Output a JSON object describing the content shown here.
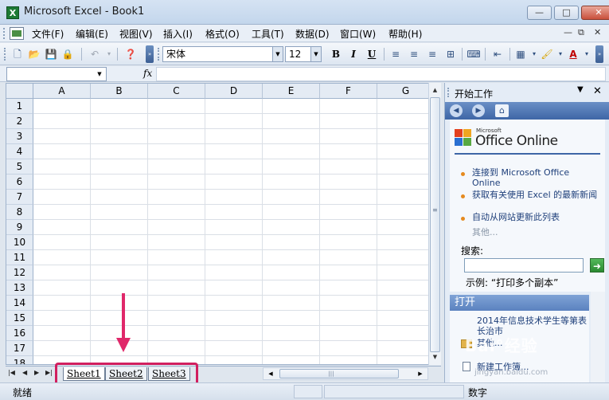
{
  "window": {
    "app_icon": "X",
    "title": "Microsoft Excel - Book1",
    "minimize": "—",
    "restore": "□",
    "close": "✕"
  },
  "menubar": {
    "items": [
      "文件(F)",
      "编辑(E)",
      "视图(V)",
      "插入(I)",
      "格式(O)",
      "工具(T)",
      "数据(D)",
      "窗口(W)",
      "帮助(H)"
    ],
    "controls": [
      "—",
      "⧉",
      "✕"
    ]
  },
  "toolbar": {
    "font_name": "宋体",
    "font_size": "12",
    "bold": "B",
    "italic": "I",
    "underline": "U"
  },
  "formula_bar": {
    "fx_label": "fx",
    "namebox_value": "",
    "formula_value": ""
  },
  "sheet": {
    "columns": [
      "A",
      "B",
      "C",
      "D",
      "E",
      "F",
      "G"
    ],
    "rows": [
      "1",
      "2",
      "3",
      "4",
      "5",
      "6",
      "7",
      "8",
      "9",
      "10",
      "11",
      "12",
      "13",
      "14",
      "15",
      "16",
      "17",
      "18"
    ],
    "tabs": [
      "Sheet1",
      "Sheet2",
      "Sheet3"
    ],
    "scroll_grip": "|||"
  },
  "status": {
    "left": "就绪",
    "right": "数字"
  },
  "task_pane": {
    "title": "开始工作",
    "logo_small": "Microsoft",
    "logo_big": "Office Online",
    "links": [
      "连接到 Microsoft Office Online",
      "获取有关使用 Excel 的最新新闻",
      "自动从网站更新此列表"
    ],
    "more": "其他...",
    "search_label": "搜索:",
    "search_value": "",
    "example": "示例: “打印多个副本”",
    "open_section": "打开",
    "open_items": [
      "2014年信息技术学生等第表长治市",
      "其他..."
    ],
    "new_item": "新建工作簿..."
  },
  "watermark": {
    "brand": "Bai°经验",
    "url": "jingyan.baidu.com"
  },
  "colors": {
    "annotation_arrow": "#e0286a",
    "annotation_box": "#d11f5f",
    "excel_green": "#1d7a34"
  }
}
